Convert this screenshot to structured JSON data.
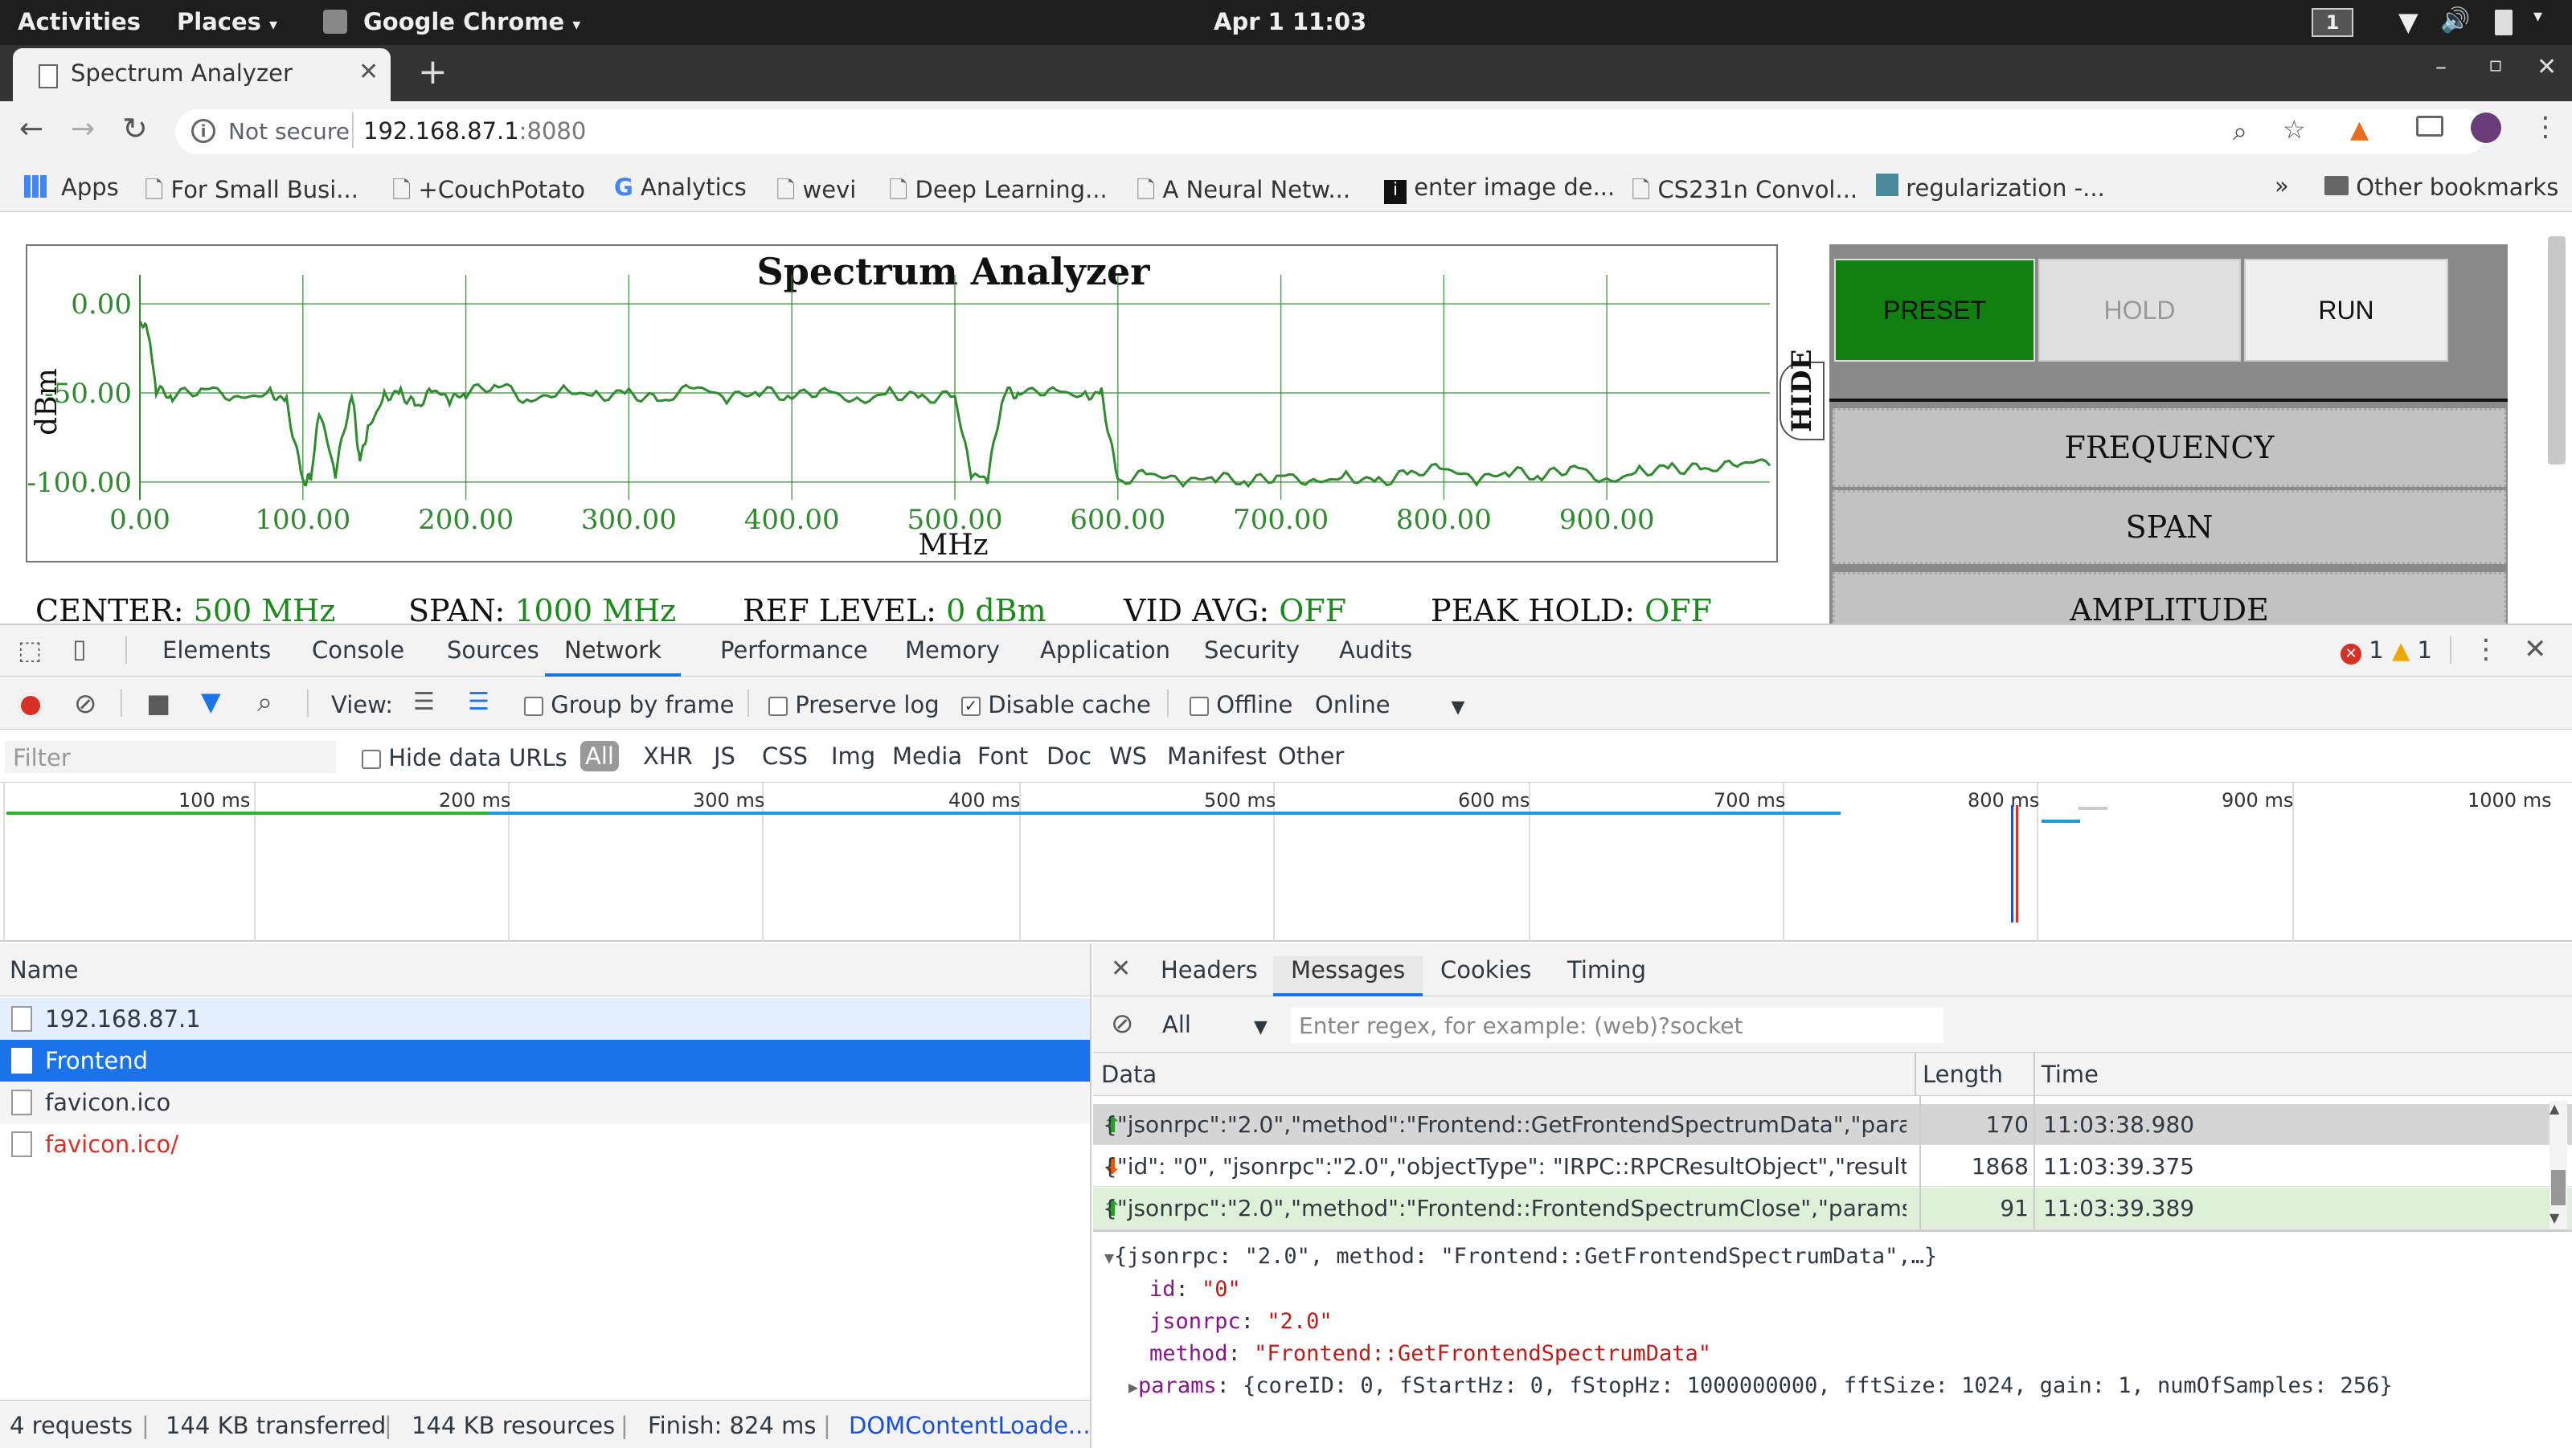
{
  "topbar": {
    "activities": "Activities",
    "places": "Places",
    "app": "Google Chrome",
    "clock": "Apr 1  11:03",
    "workspace": "1"
  },
  "tab": {
    "title": "Spectrum Analyzer"
  },
  "address": {
    "not_secure": "Not secure",
    "host": "192.168.87.1",
    "port": ":8080"
  },
  "bookmarks": {
    "items": [
      "Apps",
      "For Small Busi...",
      "+CouchPotato",
      "Analytics",
      "wevi",
      "Deep Learning...",
      "A Neural Netw...",
      "enter image de...",
      "CS231n Convol...",
      "regularization -..."
    ],
    "other": "Other bookmarks",
    "more": "»"
  },
  "analyzer": {
    "title": "Spectrum Analyzer",
    "ylabel": "dBm",
    "xlabel": "MHz",
    "hide_label": "HIDE",
    "buttons": {
      "preset": "PRESET",
      "hold": "HOLD",
      "run": "RUN"
    },
    "menu": [
      "FREQUENCY",
      "SPAN",
      "AMPLITUDE"
    ],
    "status": [
      {
        "k": "CENTER: ",
        "v": "500 MHz"
      },
      {
        "k": "SPAN: ",
        "v": "1000 MHz"
      },
      {
        "k": "REF LEVEL: ",
        "v": "0 dBm"
      },
      {
        "k": "VID AVG: ",
        "v": "OFF"
      },
      {
        "k": "PEAK HOLD: ",
        "v": "OFF"
      }
    ],
    "colors": {
      "trace": "#2e8b2e",
      "preset": "#108010",
      "value": "#1a8a1a"
    }
  },
  "chart_data": {
    "type": "line",
    "title": "Spectrum Analyzer",
    "xlabel": "MHz",
    "ylabel": "dBm",
    "xlim": [
      0,
      1000
    ],
    "ylim": [
      -110,
      10
    ],
    "x_ticks": [
      "0.00",
      "100.00",
      "200.00",
      "300.00",
      "400.00",
      "500.00",
      "600.00",
      "700.00",
      "800.00",
      "900.00"
    ],
    "y_ticks": [
      "0.00",
      "-50.00",
      "-100.00"
    ],
    "grid": true,
    "series": [
      {
        "x": [
          0,
          5,
          10,
          20,
          40,
          60,
          80,
          90,
          100,
          105,
          110,
          120,
          130,
          135,
          140,
          150,
          160,
          170,
          180,
          190,
          200,
          220,
          240,
          260,
          280,
          300,
          320,
          340,
          360,
          380,
          400,
          420,
          440,
          460,
          480,
          500,
          510,
          520,
          530,
          540,
          560,
          580,
          590,
          600,
          620,
          640,
          660,
          680,
          700,
          720,
          740,
          760,
          780,
          800,
          820,
          840,
          860,
          880,
          900,
          920,
          940,
          960,
          980,
          1000
        ],
        "y": [
          -10,
          -15,
          -48,
          -52,
          -47,
          -53,
          -50,
          -55,
          -100,
          -98,
          -60,
          -95,
          -50,
          -88,
          -70,
          -52,
          -50,
          -58,
          -48,
          -54,
          -50,
          -45,
          -55,
          -48,
          -52,
          -50,
          -55,
          -46,
          -53,
          -49,
          -52,
          -48,
          -55,
          -50,
          -53,
          -52,
          -96,
          -98,
          -50,
          -50,
          -48,
          -52,
          -50,
          -100,
          -95,
          -100,
          -97,
          -100,
          -96,
          -100,
          -97,
          -100,
          -95,
          -92,
          -99,
          -94,
          -97,
          -91,
          -100,
          -94,
          -92,
          -93,
          -90,
          -88
        ]
      }
    ]
  },
  "devtools": {
    "tabs": [
      "Elements",
      "Console",
      "Sources",
      "Network",
      "Performance",
      "Memory",
      "Application",
      "Security",
      "Audits"
    ],
    "active_tab": "Network",
    "errors": "1",
    "warnings": "1",
    "toolbar": {
      "view": "View:",
      "group": "Group by frame",
      "preserve": "Preserve log",
      "disable_cache": "Disable cache",
      "offline": "Offline",
      "throttle": "Online"
    },
    "filter": {
      "placeholder": "Filter",
      "hide_data": "Hide data URLs",
      "types": [
        "All",
        "XHR",
        "JS",
        "CSS",
        "Img",
        "Media",
        "Font",
        "Doc",
        "WS",
        "Manifest",
        "Other"
      ]
    },
    "timeline": [
      "100 ms",
      "200 ms",
      "300 ms",
      "400 ms",
      "500 ms",
      "600 ms",
      "700 ms",
      "800 ms",
      "900 ms",
      "1000 ms"
    ],
    "requests_header": "Name",
    "requests": [
      {
        "name": "192.168.87.1"
      },
      {
        "name": "Frontend"
      },
      {
        "name": "favicon.ico"
      },
      {
        "name": "favicon.ico/"
      }
    ],
    "detail_tabs": [
      "Headers",
      "Messages",
      "Cookies",
      "Timing"
    ],
    "active_detail": "Messages",
    "msg_filter": {
      "select": "All",
      "placeholder": "Enter regex, for example: (web)?socket"
    },
    "msg_cols": {
      "data": "Data",
      "length": "Length",
      "time": "Time"
    },
    "messages": [
      {
        "dir": "up",
        "data": "{\"jsonrpc\":\"2.0\",\"method\":\"Frontend::GetFrontendSpectrumData\",\"para...",
        "length": "170",
        "time": "11:03:38.980"
      },
      {
        "dir": "down",
        "data": "{\"id\": \"0\", \"jsonrpc\":\"2.0\",\"objectType\": \"IRPC::RPCResultObject\",\"result...",
        "length": "1868",
        "time": "11:03:39.375"
      },
      {
        "dir": "up",
        "data": "{\"jsonrpc\":\"2.0\",\"method\":\"Frontend::FrontendSpectrumClose\",\"params...",
        "length": "91",
        "time": "11:03:39.389"
      }
    ],
    "preview": {
      "summary": "{jsonrpc: \"2.0\", method: \"Frontend::GetFrontendSpectrumData\",…}",
      "id_k": "id",
      "id_v": "\"0\"",
      "jsonrpc_k": "jsonrpc",
      "jsonrpc_v": "\"2.0\"",
      "method_k": "method",
      "method_v": "\"Frontend::GetFrontendSpectrumData\"",
      "params_k": "params",
      "params_v": "{coreID: 0, fStartHz: 0, fStopHz: 1000000000, fftSize: 1024, gain: 1, numOfSamples: 256}"
    },
    "status": {
      "requests": "4 requests",
      "transferred": "144 KB transferred",
      "resources": "144 KB resources",
      "finish": "Finish: 824 ms",
      "dcl": "DOMContentLoade..."
    }
  }
}
